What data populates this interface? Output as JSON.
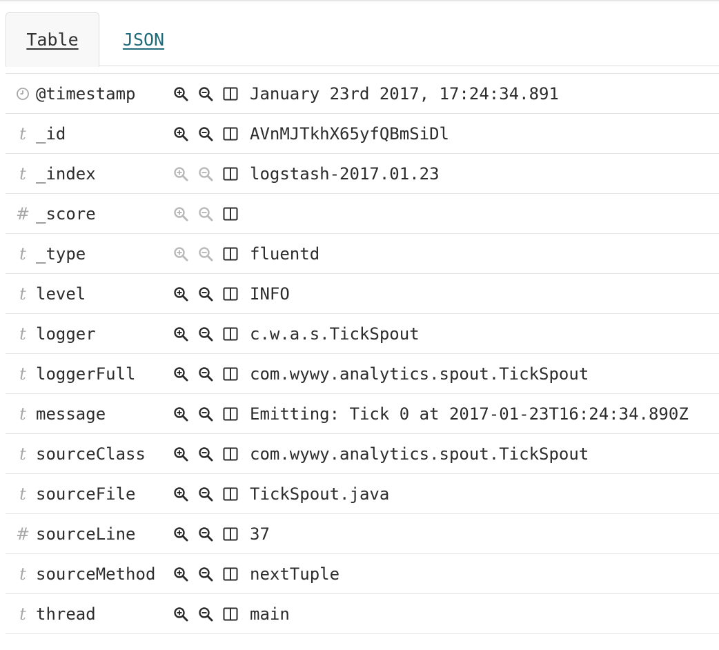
{
  "tabs": [
    {
      "label": "Table",
      "active": true
    },
    {
      "label": "JSON",
      "active": false
    }
  ],
  "colors": {
    "icon_dark": "#2b2b2b",
    "icon_disabled": "#b9b9b9",
    "type_icon": "#a8a8a8",
    "link": "#1f6b7a"
  },
  "rows": [
    {
      "type_icon": "clock-icon",
      "type_glyph": "",
      "field": "@timestamp",
      "value": "January 23rd 2017, 17:24:34.891",
      "filter_enabled": true
    },
    {
      "type_icon": "string-type-icon",
      "type_glyph": "t",
      "field": "_id",
      "value": "AVnMJTkhX65yfQBmSiDl",
      "filter_enabled": true
    },
    {
      "type_icon": "string-type-icon",
      "type_glyph": "t",
      "field": "_index",
      "value": "logstash-2017.01.23",
      "filter_enabled": false
    },
    {
      "type_icon": "number-type-icon",
      "type_glyph": "#",
      "field": "_score",
      "value": "",
      "filter_enabled": false
    },
    {
      "type_icon": "string-type-icon",
      "type_glyph": "t",
      "field": "_type",
      "value": "fluentd",
      "filter_enabled": false
    },
    {
      "type_icon": "string-type-icon",
      "type_glyph": "t",
      "field": "level",
      "value": "INFO",
      "filter_enabled": true
    },
    {
      "type_icon": "string-type-icon",
      "type_glyph": "t",
      "field": "logger",
      "value": "c.w.a.s.TickSpout",
      "filter_enabled": true
    },
    {
      "type_icon": "string-type-icon",
      "type_glyph": "t",
      "field": "loggerFull",
      "value": "com.wywy.analytics.spout.TickSpout",
      "filter_enabled": true
    },
    {
      "type_icon": "string-type-icon",
      "type_glyph": "t",
      "field": "message",
      "value": "Emitting: Tick 0 at 2017-01-23T16:24:34.890Z",
      "filter_enabled": true
    },
    {
      "type_icon": "string-type-icon",
      "type_glyph": "t",
      "field": "sourceClass",
      "value": "com.wywy.analytics.spout.TickSpout",
      "filter_enabled": true
    },
    {
      "type_icon": "string-type-icon",
      "type_glyph": "t",
      "field": "sourceFile",
      "value": "TickSpout.java",
      "filter_enabled": true
    },
    {
      "type_icon": "number-type-icon",
      "type_glyph": "#",
      "field": "sourceLine",
      "value": "37",
      "filter_enabled": true
    },
    {
      "type_icon": "string-type-icon",
      "type_glyph": "t",
      "field": "sourceMethod",
      "value": "nextTuple",
      "filter_enabled": true
    },
    {
      "type_icon": "string-type-icon",
      "type_glyph": "t",
      "field": "thread",
      "value": "main",
      "filter_enabled": true
    }
  ],
  "actions": {
    "filter_for_icon": "zoom-in-icon",
    "filter_out_icon": "zoom-out-icon",
    "toggle_column_icon": "columns-icon"
  }
}
